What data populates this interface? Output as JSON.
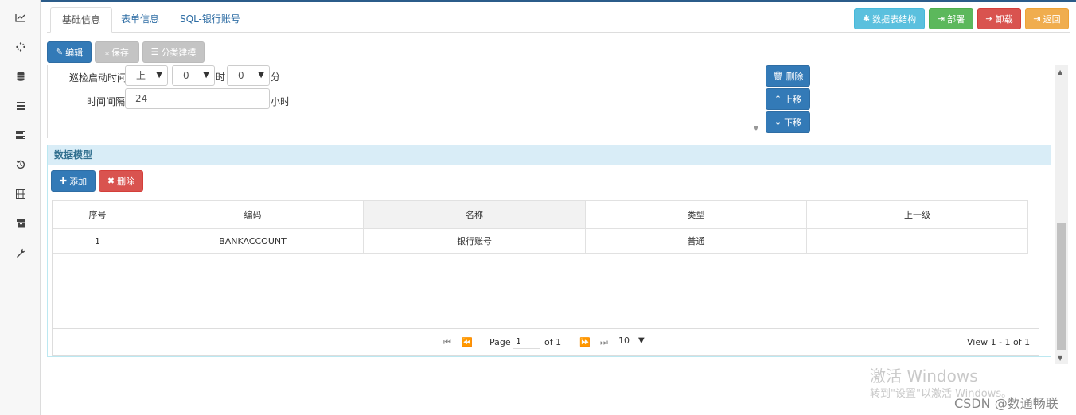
{
  "rail": {
    "icons": [
      "chart-line-icon",
      "spinner-icon",
      "database-icon",
      "list-icon",
      "server-icon",
      "history-icon",
      "film-icon",
      "archive-icon",
      "wrench-icon"
    ]
  },
  "tabs": [
    {
      "label": "基础信息",
      "active": true
    },
    {
      "label": "表单信息",
      "active": false
    },
    {
      "label": "SQL-银行账号",
      "active": false
    }
  ],
  "top_actions": {
    "structure": "数据表结构",
    "deploy": "部署",
    "unload": "卸载",
    "back": "返回"
  },
  "toolbar": {
    "edit": "编辑",
    "save": "保存",
    "modeling": "分类建模"
  },
  "form": {
    "patrol_label": "巡检启动时间",
    "ampm_value": "上",
    "hour_value": "0",
    "hour_unit": "时",
    "minute_value": "0",
    "minute_unit": "分",
    "interval_label": "时间间隔",
    "interval_value": "24",
    "interval_unit": "小时"
  },
  "list_buttons": {
    "delete": "删除",
    "move_up": "上移",
    "move_down": "下移"
  },
  "data_model": {
    "title": "数据模型",
    "add": "添加",
    "delete": "删除",
    "columns": [
      "序号",
      "编码",
      "名称",
      "类型",
      "上一级"
    ],
    "rows": [
      [
        "1",
        "BANKACCOUNT",
        "银行账号",
        "普通",
        ""
      ]
    ]
  },
  "pager": {
    "page_label": "Page",
    "page_value": "1",
    "of_label": "of 1",
    "page_size": "10",
    "view_text": "View 1 - 1 of 1"
  },
  "overlay": {
    "activate_title": "激活 Windows",
    "activate_hint": "转到\"设置\"以激活 Windows。",
    "csdn": "CSDN @数通畅联"
  },
  "colors": {
    "primary": "#337ab7",
    "info": "#5bc0de",
    "success": "#5cb85c",
    "danger": "#d9534f",
    "warning": "#f0ad4e",
    "panel_head": "#d9edf7"
  }
}
